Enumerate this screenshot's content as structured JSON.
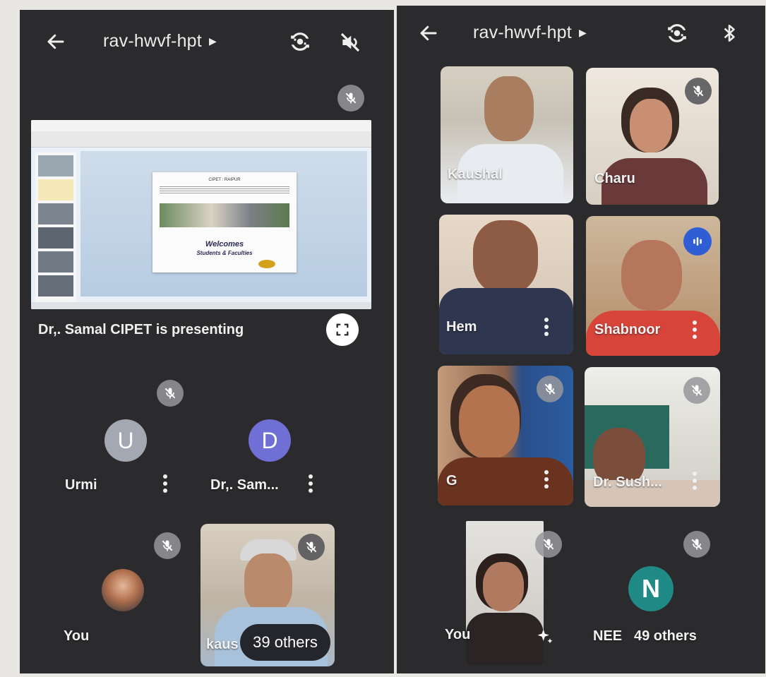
{
  "left_screen": {
    "header": {
      "meeting_code": "rav-hwvf-hpt",
      "back_icon": "arrow-left-icon",
      "camera_switch_icon": "camera-flip-icon",
      "audio_icon": "speaker-muted-icon"
    },
    "presentation": {
      "slide_header": "CIPET : RAIPUR",
      "slide_welcome": "Welcomes",
      "slide_subtitle": "Students & Faculties",
      "presenting_text": "Dr,. Samal CIPET is presenting",
      "fullscreen_icon": "fullscreen-icon"
    },
    "participants": [
      {
        "initial": "U",
        "name": "Urmi",
        "color": "#a3a8b3"
      },
      {
        "initial": "D",
        "name": "Dr,. Sam...",
        "color": "#6f6fd6"
      }
    ],
    "self_tile": {
      "name": "You"
    },
    "others_tile": {
      "name": "kaus",
      "others_label": "39 others"
    }
  },
  "right_screen": {
    "header": {
      "meeting_code": "rav-hwvf-hpt",
      "back_icon": "arrow-left-icon",
      "camera_switch_icon": "camera-flip-icon",
      "bluetooth_icon": "bluetooth-icon"
    },
    "tiles": [
      {
        "name": "Kaushal"
      },
      {
        "name": "Charu"
      },
      {
        "name": "Hem"
      },
      {
        "name": "Shabnoor"
      },
      {
        "name": "G"
      },
      {
        "name": "Dr. Sush..."
      }
    ],
    "self_tile": {
      "name": "You",
      "effects_icon": "sparkle-icon"
    },
    "others_tile": {
      "initial": "N",
      "name": "NEE",
      "others_label": "49 others",
      "color": "#1f8a86"
    }
  }
}
